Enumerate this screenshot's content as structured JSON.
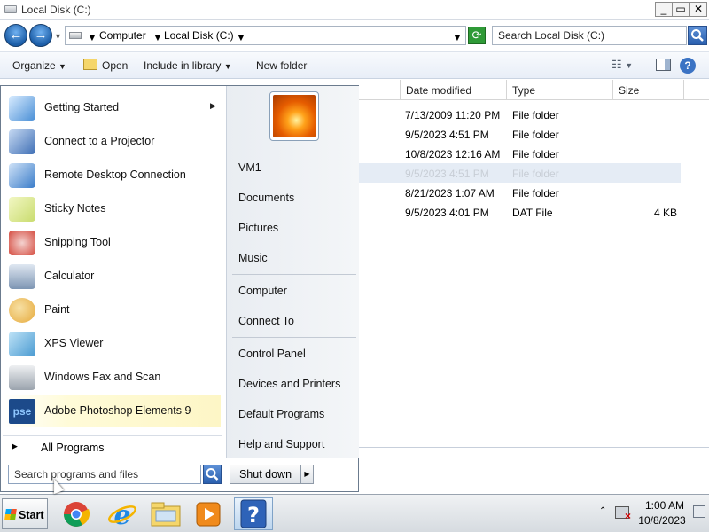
{
  "window": {
    "title": "Local Disk (C:)",
    "minimize_glyph": "_",
    "maximize_glyph": "▭",
    "close_glyph": "✕"
  },
  "address": {
    "back_glyph": "←",
    "forward_glyph": "→",
    "segments": [
      "Computer",
      "Local Disk (C:)"
    ],
    "search_placeholder": "Search Local Disk (C:)"
  },
  "toolbar": {
    "organize": "Organize",
    "open": "Open",
    "include_in_library": "Include in library",
    "new_folder": "New folder"
  },
  "columns": [
    "Date modified",
    "Type",
    "Size"
  ],
  "files": [
    {
      "date": "7/13/2009 11:20 PM",
      "type": "File folder",
      "size": ""
    },
    {
      "date": "9/5/2023 4:51 PM",
      "type": "File folder",
      "size": ""
    },
    {
      "date": "10/8/2023 12:16 AM",
      "type": "File folder",
      "size": ""
    },
    {
      "date": "9/5/2023 4:51 PM",
      "type": "File folder",
      "size": ""
    },
    {
      "date": "8/21/2023 1:07 AM",
      "type": "File folder",
      "size": ""
    },
    {
      "date": "9/5/2023 4:01 PM",
      "type": "DAT File",
      "size": "4 KB"
    }
  ],
  "start_menu": {
    "programs": [
      {
        "label": "Getting Started",
        "icon": "getting-started-icon",
        "color": "#4a8fd6",
        "submenu": true
      },
      {
        "label": "Connect to a Projector",
        "icon": "projector-icon",
        "color": "#3f6fb5",
        "submenu": false
      },
      {
        "label": "Remote Desktop Connection",
        "icon": "remote-desktop-icon",
        "color": "#3a7cc9",
        "submenu": false
      },
      {
        "label": "Sticky Notes",
        "icon": "sticky-notes-icon",
        "color": "#c9dc6e",
        "submenu": false
      },
      {
        "label": "Snipping Tool",
        "icon": "snipping-tool-icon",
        "color": "#d44a3e",
        "submenu": false
      },
      {
        "label": "Calculator",
        "icon": "calculator-icon",
        "color": "#7d95b3",
        "submenu": false
      },
      {
        "label": "Paint",
        "icon": "paint-icon",
        "color": "#e6a93a",
        "submenu": false
      },
      {
        "label": "XPS Viewer",
        "icon": "xps-viewer-icon",
        "color": "#4a9ad1",
        "submenu": false
      },
      {
        "label": "Windows Fax and Scan",
        "icon": "fax-scan-icon",
        "color": "#9aa3ad",
        "submenu": false
      },
      {
        "label": "Adobe Photoshop Elements 9",
        "icon": "photoshop-elements-icon",
        "color": "#1c4a8a",
        "submenu": false
      }
    ],
    "pse_text": "pse",
    "all_programs": "All Programs",
    "search_placeholder": "Search programs and files",
    "places": [
      "VM1",
      "Documents",
      "Pictures",
      "Music",
      "Computer",
      "Connect To",
      "Control Panel",
      "Devices and Printers",
      "Default Programs",
      "Help and Support"
    ],
    "shutdown": "Shut down",
    "shutdown_arrow": "▶"
  },
  "taskbar": {
    "start": "Start",
    "pinned": [
      {
        "name": "chrome-icon"
      },
      {
        "name": "internet-explorer-icon"
      },
      {
        "name": "windows-explorer-icon"
      },
      {
        "name": "media-player-icon"
      },
      {
        "name": "help-icon"
      }
    ],
    "help_glyph": "?",
    "tray_arrow": "⌃",
    "time": "1:00 AM",
    "date": "10/8/2023"
  }
}
